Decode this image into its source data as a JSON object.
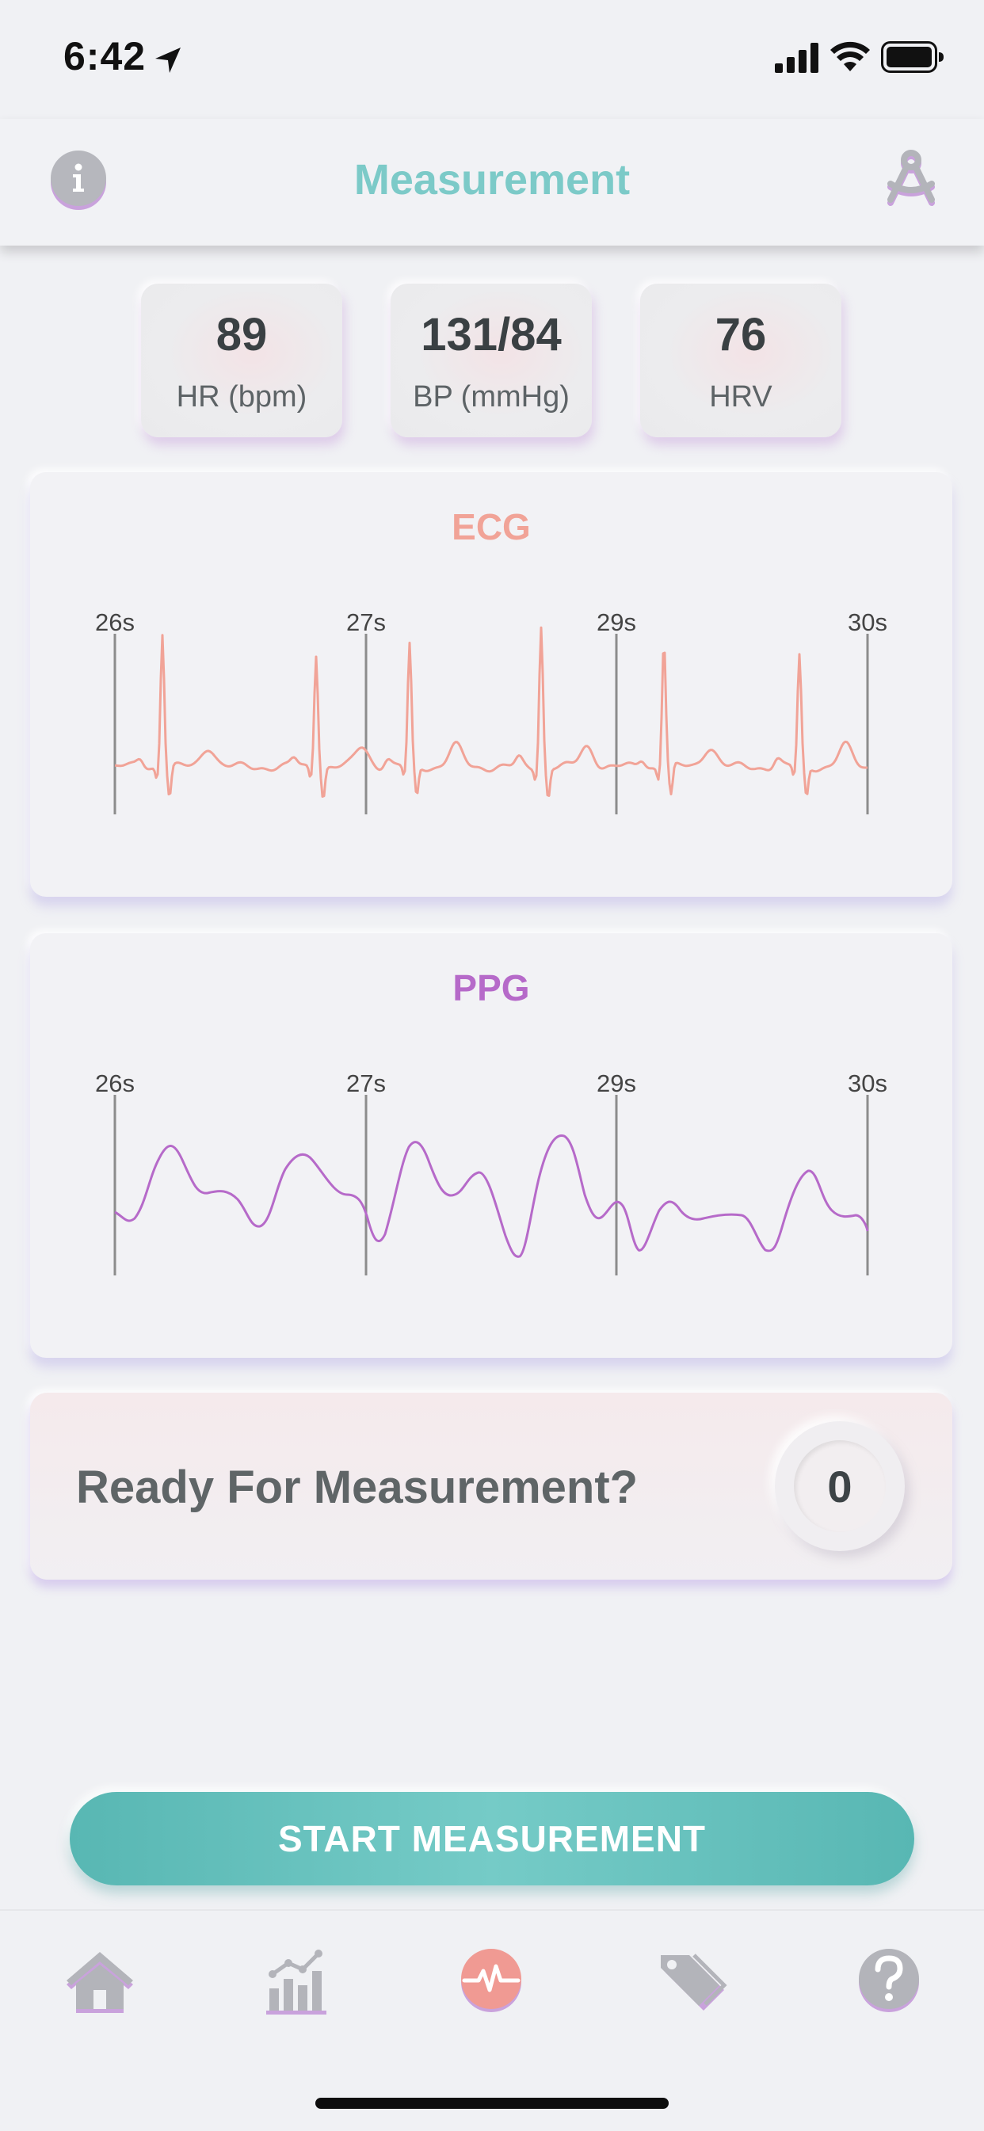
{
  "status": {
    "time": "6:42"
  },
  "header": {
    "title": "Measurement"
  },
  "metrics": [
    {
      "value": "89",
      "label": "HR (bpm)"
    },
    {
      "value": "131/84",
      "label": "BP (mmHg)"
    },
    {
      "value": "76",
      "label": "HRV"
    }
  ],
  "charts": {
    "ecg": {
      "title": "ECG",
      "color": "#f1a397",
      "ticks": [
        "26s",
        "27s",
        "29s",
        "30s"
      ]
    },
    "ppg": {
      "title": "PPG",
      "color": "#b66ac9",
      "ticks": [
        "26s",
        "27s",
        "29s",
        "30s"
      ]
    }
  },
  "ready": {
    "text": "Ready For Measurement?",
    "count": "0"
  },
  "start_button": {
    "label": "START MEASUREMENT"
  },
  "tabs": [
    {
      "icon": "home-icon",
      "active": false
    },
    {
      "icon": "bar-chart-icon",
      "active": false
    },
    {
      "icon": "heart-pulse-icon",
      "active": true
    },
    {
      "icon": "tags-icon",
      "active": false
    },
    {
      "icon": "help-icon",
      "active": false
    }
  ],
  "colors": {
    "accent": "#7ccac8",
    "button": "#5cb9b5",
    "ecg": "#f1a397",
    "ppg": "#b66ac9",
    "active_tab": "#f09a93",
    "icon": "#b3b4ba",
    "icon_shadow": "#c9a2dc"
  }
}
